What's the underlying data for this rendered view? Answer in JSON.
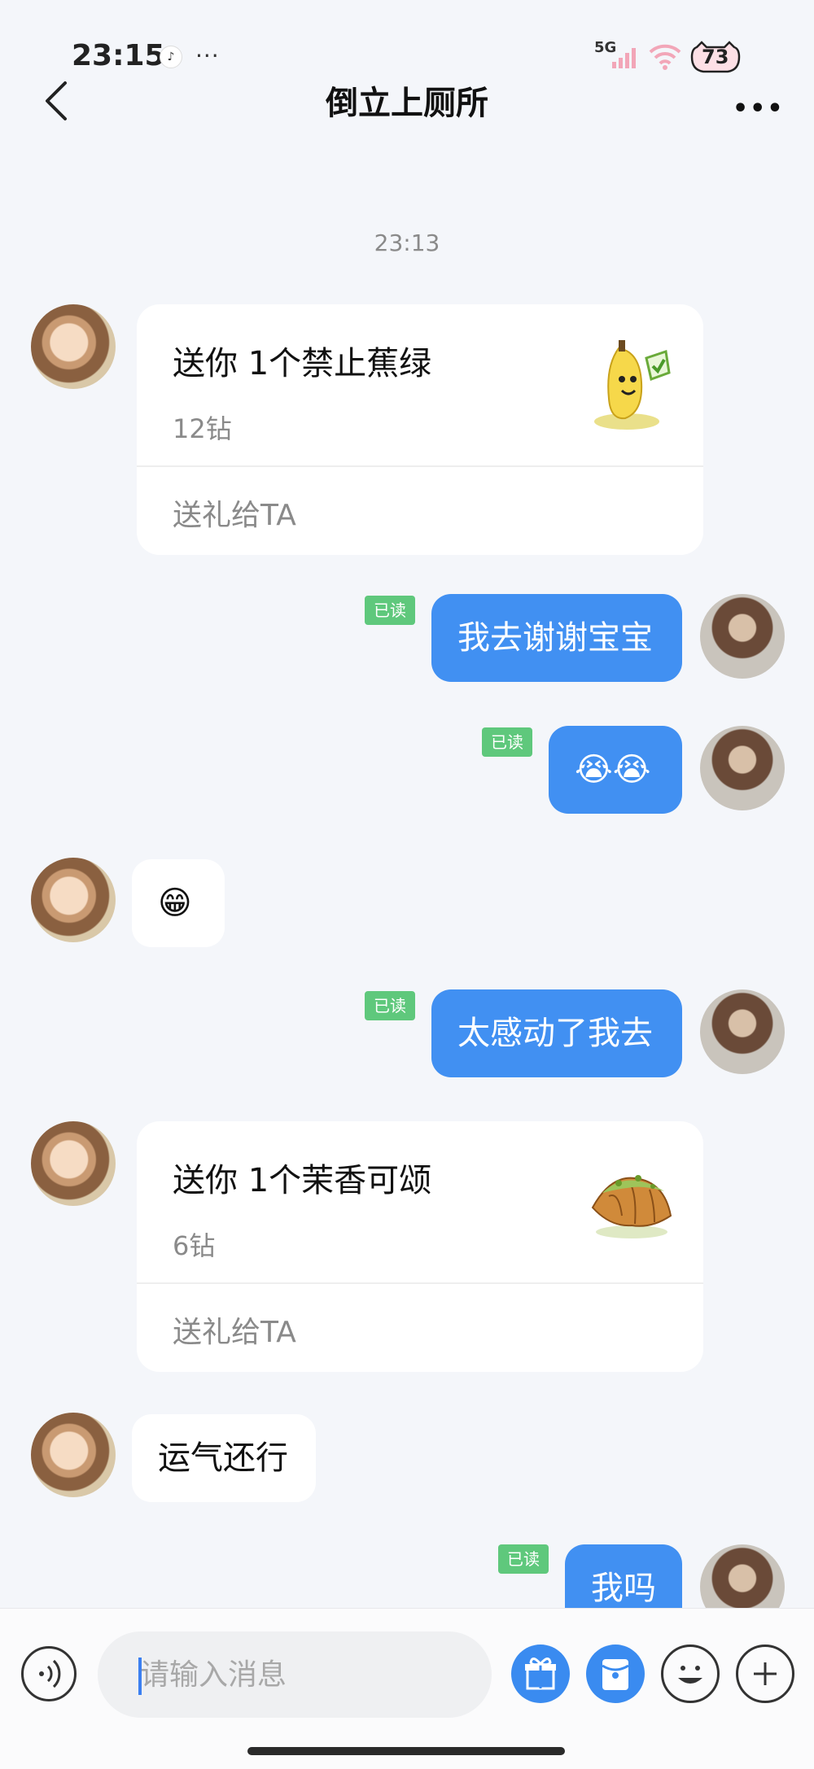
{
  "status_bar": {
    "time": "23:15",
    "app_badge": "♪",
    "dots": "···",
    "network": "5G",
    "battery": "73"
  },
  "header": {
    "title": "倒立上厕所",
    "more": "•••"
  },
  "chat": {
    "timestamp": "23:13",
    "read_label": "已读",
    "gift1": {
      "title": "送你 1个禁止蕉绿",
      "price": "12钻",
      "action": "送礼给TA"
    },
    "msg1": "我去谢谢宝宝",
    "msg2": "😭😭",
    "msg3": "😁",
    "msg4": "太感动了我去",
    "gift2": {
      "title": "送你 1个茉香可颂",
      "price": "6钻",
      "action": "送礼给TA"
    },
    "msg5": "运气还行",
    "msg6": "我吗"
  },
  "input": {
    "placeholder": "请输入消息"
  },
  "colors": {
    "bubble_me": "#4190f2",
    "read_badge": "#5fc87c",
    "background": "#f4f6fa"
  }
}
